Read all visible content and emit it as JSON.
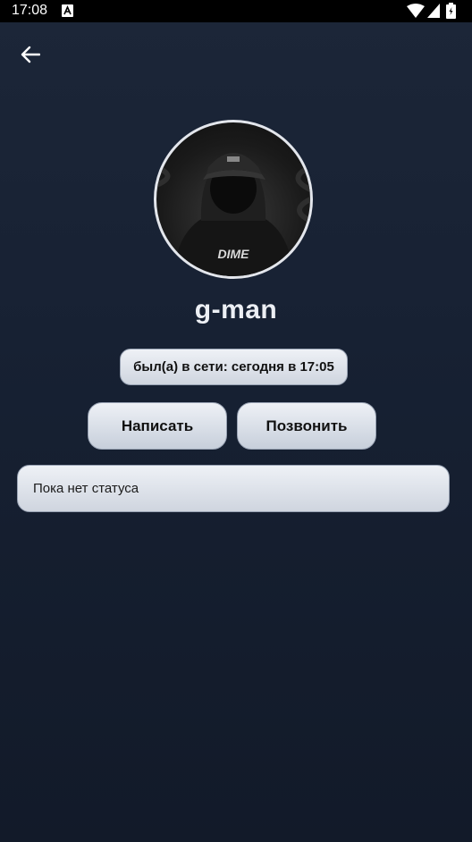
{
  "status_bar": {
    "time": "17:08"
  },
  "profile": {
    "username": "g-man",
    "last_seen": "был(а) в сети: сегодня в 17:05",
    "avatar_text": "DIME",
    "status_text": "Пока нет статуса"
  },
  "actions": {
    "write_label": "Написать",
    "call_label": "Позвонить"
  }
}
